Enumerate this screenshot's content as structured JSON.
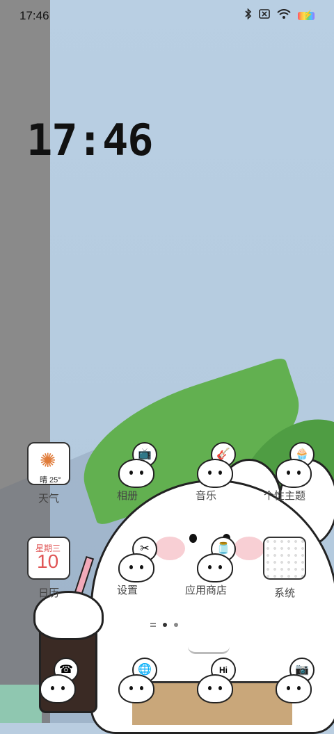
{
  "status_bar": {
    "time": "17:46",
    "icons": [
      "bluetooth-icon",
      "no-sim-icon",
      "wifi-icon",
      "battery-charging-icon"
    ]
  },
  "lock_clock": {
    "time": "17:46"
  },
  "weather_widget": {
    "text": "晴 25°"
  },
  "calendar_widget": {
    "weekday": "星期三",
    "day": "10"
  },
  "apps_row1": [
    {
      "label": "天气"
    },
    {
      "label": "相册"
    },
    {
      "label": "音乐"
    },
    {
      "label": "个性主题"
    }
  ],
  "apps_row2": [
    {
      "label": "日历"
    },
    {
      "label": "设置"
    },
    {
      "label": "应用商店"
    },
    {
      "label": "系统"
    }
  ],
  "dock_badges": [
    "Hi"
  ],
  "page_indicator": {
    "pages": 3,
    "active": 2
  }
}
